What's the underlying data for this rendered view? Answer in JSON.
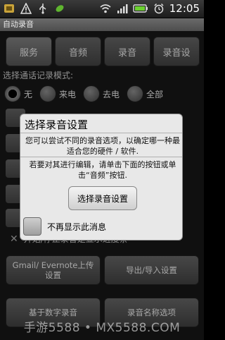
{
  "status_bar": {
    "time": "12:05",
    "icons_left": [
      "app-notification-icon",
      "warning-icon",
      "usb-icon",
      "leaf-icon"
    ],
    "icons_right": [
      "wifi-icon",
      "signal-icon",
      "battery-icon",
      "alarm-icon"
    ]
  },
  "app": {
    "title": "自动录音"
  },
  "tabs": [
    {
      "label": "服务"
    },
    {
      "label": "音频"
    },
    {
      "label": "录音"
    },
    {
      "label": "录音设"
    }
  ],
  "mode": {
    "label": "选择通话记录模式:",
    "options": [
      {
        "label": "无",
        "selected": true
      },
      {
        "label": "来电",
        "selected": false
      },
      {
        "label": "去电",
        "selected": false
      },
      {
        "label": "全部",
        "selected": false
      }
    ]
  },
  "progress_option": {
    "label": "开始/停止录音是显示进度条"
  },
  "buttons": {
    "gmail_upload": "Gmail/ Evernote上传设置",
    "export_import": "导出/导入设置",
    "number_record": "基于数字录音",
    "name_options": "录音名称选项"
  },
  "dialog": {
    "title": "选择录音设置",
    "text1": "您可以尝试不同的录音选项，以确定哪一种最适合您的硬件 / 软件.",
    "text2": "若要对其进行编辑，请单击下面的按钮或单击“音频”按钮.",
    "button": "选择录音设置",
    "checkbox_label": "不再显示此消息"
  },
  "watermark": "手游5588 • MX5588.COM"
}
